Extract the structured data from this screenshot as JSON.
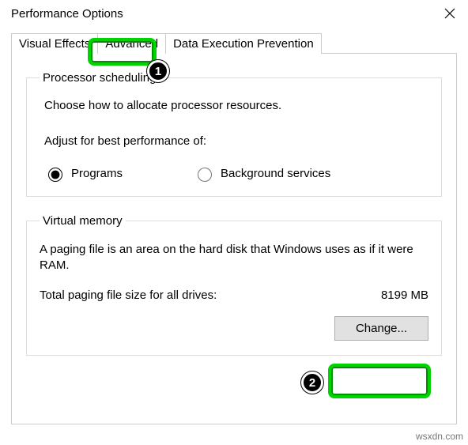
{
  "window": {
    "title": "Performance Options"
  },
  "tabs": {
    "visual_effects": "Visual Effects",
    "advanced": "Advanced",
    "dep": "Data Execution Prevention"
  },
  "processor": {
    "legend": "Processor scheduling",
    "desc": "Choose how to allocate processor resources.",
    "adjust_label": "Adjust for best performance of:",
    "opt_programs": "Programs",
    "opt_background": "Background services"
  },
  "vm": {
    "legend": "Virtual memory",
    "desc": "A paging file is an area on the hard disk that Windows uses as if it were RAM.",
    "size_label": "Total paging file size for all drives:",
    "size_value": "8199 MB",
    "change_btn": "Change..."
  },
  "annotations": {
    "one": "1",
    "two": "2"
  },
  "watermark": "wsxdn.com"
}
